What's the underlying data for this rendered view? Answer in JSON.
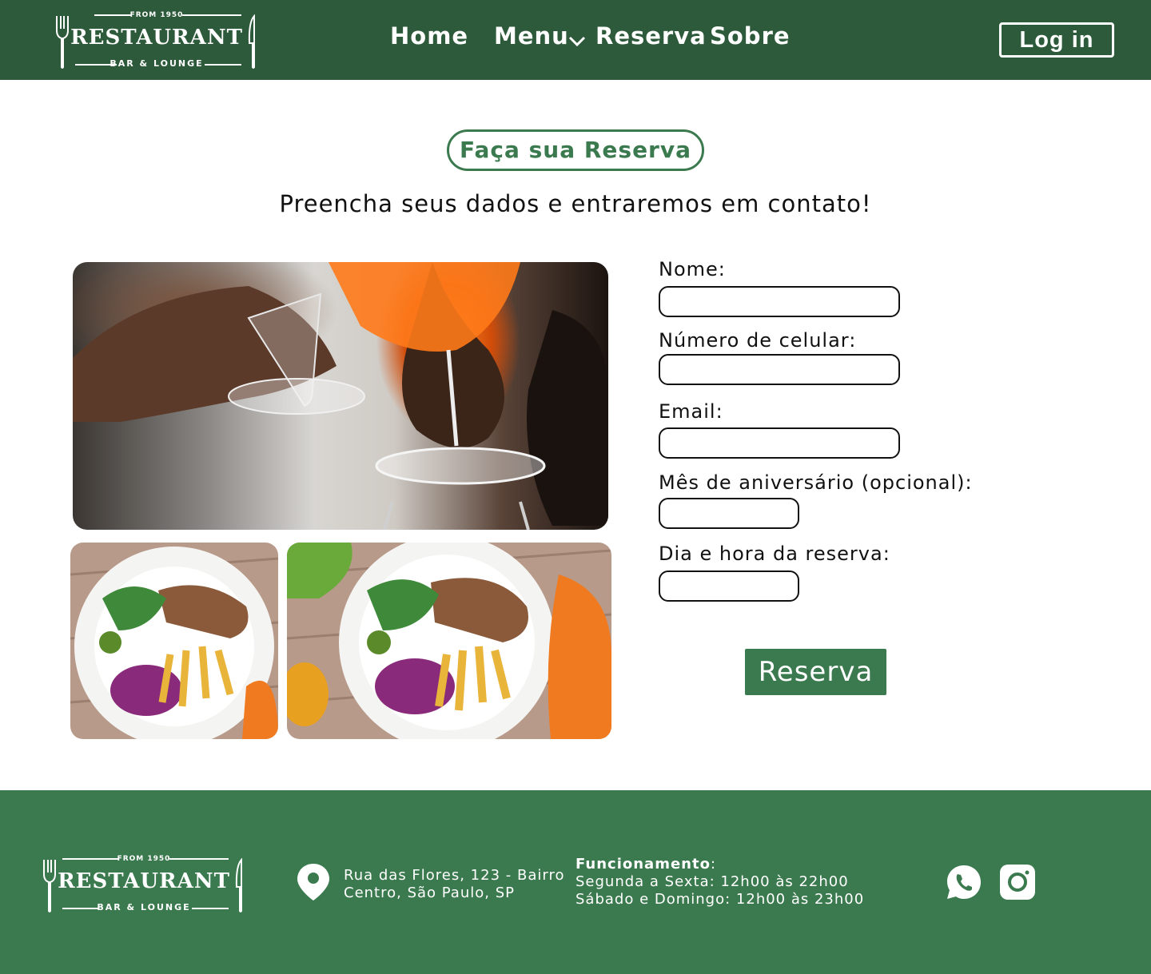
{
  "brand": {
    "tagline_top": "FROM 1950",
    "name": "RESTAURANT",
    "tagline_bottom": "BAR & LOUNGE"
  },
  "nav": {
    "items": [
      {
        "label": "Home"
      },
      {
        "label": "Menu",
        "has_dropdown": true
      },
      {
        "label": "Reserva"
      },
      {
        "label": "Sobre"
      }
    ],
    "login_label": "Log in",
    "dropdown_icon": "chevron-down-icon"
  },
  "page": {
    "title": "Faça sua Reserva",
    "subtitle": "Preencha seus dados e entraremos em contato!"
  },
  "form": {
    "fields": [
      {
        "label": "Nome:",
        "value": ""
      },
      {
        "label": "Número de celular:",
        "value": ""
      },
      {
        "label": "Email:",
        "value": ""
      },
      {
        "label": "Mês de aniversário (opcional):",
        "value": ""
      },
      {
        "label": "Dia e hora da reserva:",
        "value": ""
      }
    ],
    "submit_label": "Reserva"
  },
  "footer": {
    "address_line1": "Rua das Flores, 123 - Bairro",
    "address_line2": "Centro, São Paulo, SP",
    "hours_title": "Funcionamento",
    "hours_colon": ":",
    "hours_weekdays": "Segunda a Sexta: 12h00 às 22h00",
    "hours_weekend": "Sábado e Domingo: 12h00 às 23h00",
    "icons": [
      "map-pin-icon",
      "whatsapp-icon",
      "instagram-icon"
    ]
  },
  "colors": {
    "header_bg": "#2d5a3a",
    "accent": "#3a7a4e",
    "footer_bg": "#3a7a4e",
    "text": "#111111",
    "white": "#ffffff"
  }
}
